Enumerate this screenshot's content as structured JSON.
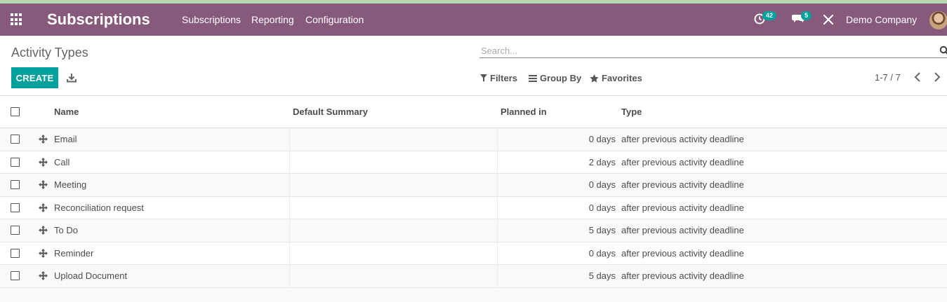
{
  "navbar": {
    "brand": "Subscriptions",
    "menu": [
      "Subscriptions",
      "Reporting",
      "Configuration"
    ],
    "activity_count": "42",
    "message_count": "5",
    "company": "Demo Company",
    "bg_color": "#875a7b"
  },
  "control": {
    "breadcrumb": "Activity Types",
    "search_placeholder": "Search...",
    "create_label": "CREATE",
    "filters_label": "Filters",
    "groupby_label": "Group By",
    "favorites_label": "Favorites",
    "pager": "1-7 / 7",
    "accent_color": "#00a09d"
  },
  "table": {
    "columns": [
      "Name",
      "Default Summary",
      "Planned in",
      "Type"
    ],
    "rows": [
      {
        "name": "Email",
        "summary": "",
        "planned": "0 days",
        "type": "after previous activity deadline"
      },
      {
        "name": "Call",
        "summary": "",
        "planned": "2 days",
        "type": "after previous activity deadline"
      },
      {
        "name": "Meeting",
        "summary": "",
        "planned": "0 days",
        "type": "after previous activity deadline"
      },
      {
        "name": "Reconciliation request",
        "summary": "",
        "planned": "0 days",
        "type": "after previous activity deadline"
      },
      {
        "name": "To Do",
        "summary": "",
        "planned": "5 days",
        "type": "after previous activity deadline"
      },
      {
        "name": "Reminder",
        "summary": "",
        "planned": "0 days",
        "type": "after previous activity deadline"
      },
      {
        "name": "Upload Document",
        "summary": "",
        "planned": "5 days",
        "type": "after previous activity deadline"
      }
    ]
  }
}
